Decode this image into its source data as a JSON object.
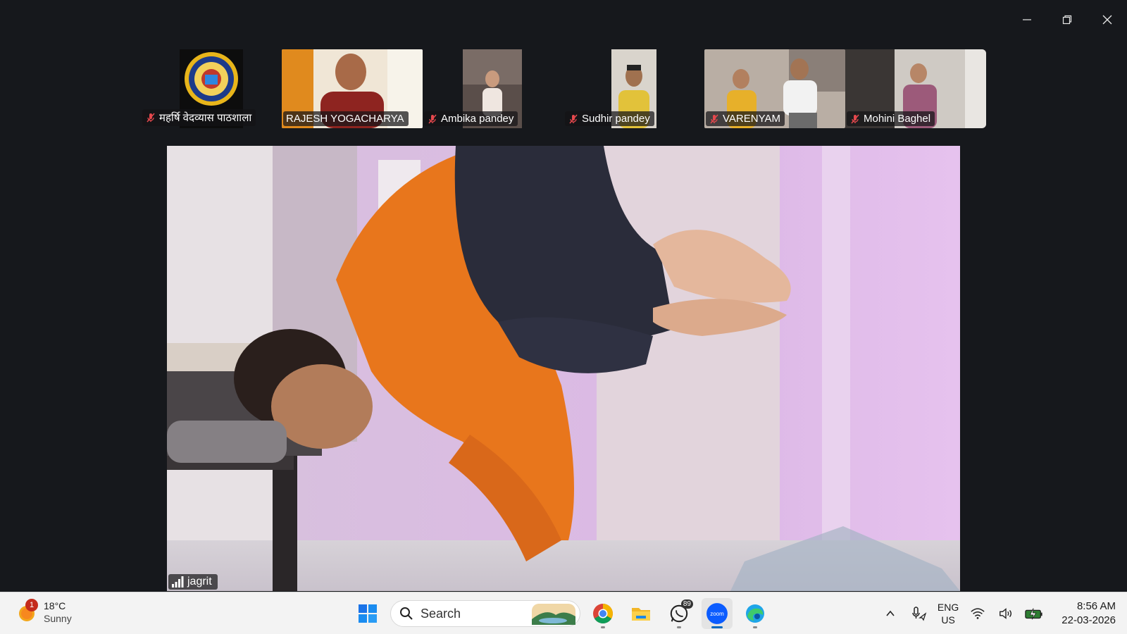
{
  "window": {
    "minimize_icon": "minimize-icon",
    "restore_icon": "restore-icon",
    "close_icon": "close-icon"
  },
  "participants": [
    {
      "name": "महर्षि वेदव्यास पाठशाला",
      "muted": true
    },
    {
      "name": "RAJESH YOGACHARYA",
      "muted": false
    },
    {
      "name": "Ambika pandey",
      "muted": true
    },
    {
      "name": "Sudhir pandey",
      "muted": true
    },
    {
      "name": "VARENYAM",
      "muted": true
    },
    {
      "name": "Mohini Baghel",
      "muted": true
    }
  ],
  "main_video": {
    "speaker_name": "jagrit",
    "signal_icon": "signal-bars-icon"
  },
  "taskbar": {
    "weather": {
      "temp": "18°C",
      "condition": "Sunny",
      "badge": "1"
    },
    "search_placeholder": "Search",
    "apps": [
      {
        "name": "start",
        "icon": "windows-logo-icon"
      },
      {
        "name": "chrome",
        "icon": "chrome-icon"
      },
      {
        "name": "file-explorer",
        "icon": "folder-icon"
      },
      {
        "name": "whatsapp",
        "icon": "whatsapp-icon",
        "badge": "89"
      },
      {
        "name": "zoom",
        "icon": "zoom-icon",
        "label": "zoom",
        "active": true
      },
      {
        "name": "edge",
        "icon": "edge-icon"
      }
    ],
    "tray": {
      "lang_top": "ENG",
      "lang_bottom": "US",
      "time": "8:56 AM",
      "date": "22-03-2026"
    }
  },
  "colors": {
    "background": "#16181c",
    "mic_muted": "#e5484d",
    "taskbar": "#f3f3f3",
    "zoom_blue": "#0b5cff"
  }
}
